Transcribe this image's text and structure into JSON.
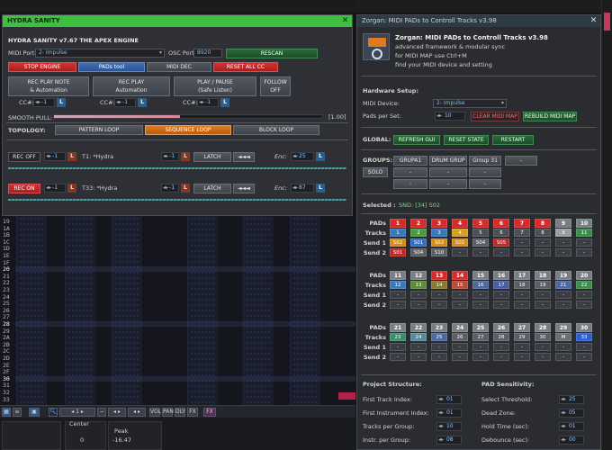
{
  "tracker": {
    "row_numbers": [
      "19",
      "1A",
      "1B",
      "1C",
      "1D",
      "1E",
      "1F",
      "20",
      "21",
      "22",
      "23",
      "24",
      "25",
      "26",
      "27",
      "28",
      "29",
      "2A",
      "2B",
      "2C",
      "2D",
      "2E",
      "2F",
      "30",
      "31",
      "32",
      "33"
    ],
    "highlight_rows": [
      "20",
      "28",
      "30"
    ]
  },
  "bottom_bar": {
    "zoom": "1",
    "items": [
      "VOL",
      "PAN",
      "DLY",
      "FX"
    ],
    "center_label": "Center",
    "center_value": "0",
    "peak_label": "Peak",
    "peak_value": "-16.47"
  },
  "hydra": {
    "window_title": "HYDRA SANITY",
    "header": "HYDRA SANITY v7.67  THE APEX ENGINE",
    "midi_port_label": "MIDI Port:",
    "midi_port_value": "2- Impulse",
    "osc_port_label": "OSC Port:",
    "osc_port_value": "8920",
    "rescan": "RESCAN",
    "stop_engine": "STOP ENGINE",
    "pads_tool": "PADs tool",
    "midi_dec": "MIDI DEC",
    "reset_all_cc": "RESET ALL CC",
    "rec_play_note": [
      "REC PLAY NOTE",
      "& Automation"
    ],
    "rec_play_auto": [
      "REC PLAY",
      "Automation"
    ],
    "play_pause": [
      "PLAY / PAUSE",
      "(Safe Listen)"
    ],
    "follow": [
      "FOLLOW",
      "OFF"
    ],
    "cc_label": "CC#:",
    "cc_value": "-1",
    "cc_chip": "L",
    "smooth_label": "SMOOTH PULL:",
    "smooth_value": "[1.00]",
    "smooth_fraction": 0.47,
    "topology_label": "TOPOLOGY:",
    "pattern_loop": "PATTERN LOOP",
    "sequence_loop": "SEQUENCE LOOP",
    "block_loop": "BLOCK LOOP",
    "tracks": [
      {
        "rec": "REC OFF",
        "rec_style": "dark",
        "num": "-1",
        "chip": "L",
        "name": "T1: *Hydra",
        "num2": "-1",
        "chip2": "L",
        "latch": "LATCH",
        "back": "◄◄◄",
        "enc_label": "Enc:",
        "enc": "25",
        "enc_chip": "L"
      },
      {
        "rec": "REC ON",
        "rec_style": "red",
        "num": "-1",
        "chip": "L",
        "name": "T33: *Hydra",
        "num2": "-1",
        "chip2": "L",
        "latch": "LATCH",
        "back": "◄◄◄",
        "enc_label": "Enc:",
        "enc": "87",
        "enc_chip": "L"
      }
    ]
  },
  "zorgan": {
    "window_title": "Zorgan: MIDI PADs to Controll Tracks v3.98",
    "app_title": "Zorgan: MIDI PADs to Controll Tracks v3.98",
    "desc1": "advanced framework & modular sync",
    "desc2": "for MIDI MAP use Ctrl+M",
    "desc3": "find your MIDI device and setting",
    "hw_setup": "Hardware Setup:",
    "midi_device_label": "MIDI Device:",
    "midi_device_value": "2- Impulse",
    "pads_per_set_label": "Pads per Set:",
    "pads_per_set_value": "10",
    "clear_midi_map": "CLEAR MIDI MAP",
    "rebuild_midi_map": "REBUILD MIDI MAP",
    "global_label": "GLOBAL:",
    "refresh_gui": "REFRESH GUI",
    "reset_state": "RESET STATE",
    "restart": "RESTART",
    "groups_label": "GROUPS:",
    "group_buttons": [
      "GRUPA1",
      "DRUM GRUP",
      "Group 31",
      "-"
    ],
    "solo": "SOLO",
    "dash": "-",
    "selected_label": "Selected :",
    "selected_value": "SND: [34] S02",
    "row_labels": [
      "PADs",
      "Tracks",
      "Send 1",
      "Send 2"
    ],
    "blocks": [
      {
        "pads": [
          [
            "1",
            "#d42c2c"
          ],
          [
            "2",
            "#d42c2c"
          ],
          [
            "3",
            "#d42c2c"
          ],
          [
            "4",
            "#d42c2c"
          ],
          [
            "5",
            "#d42c2c"
          ],
          [
            "6",
            "#d42c2c"
          ],
          [
            "7",
            "#d42c2c"
          ],
          [
            "8",
            "#d42c2c"
          ],
          [
            "9",
            "#7a7d83"
          ],
          [
            "10",
            "#7a7d83"
          ]
        ],
        "tracks": [
          [
            "1",
            "#3a7ab8"
          ],
          [
            "2",
            "#4c9a46"
          ],
          [
            "3",
            "#3a7ab8"
          ],
          [
            "4",
            "#d6a020"
          ],
          [
            "5",
            "#4a4f58"
          ],
          [
            "6",
            "#4a4f58"
          ],
          [
            "7",
            "#4a4f58"
          ],
          [
            "8",
            "#4a4f58"
          ],
          [
            "9",
            "#9a9da3"
          ],
          [
            "11",
            "#3d8d4a"
          ]
        ],
        "send1": [
          [
            "S02",
            "#d88a18"
          ],
          [
            "S01",
            "#2f6fd0"
          ],
          [
            "S02",
            "#d88a18"
          ],
          [
            "S02",
            "#d88a18"
          ],
          [
            "S04",
            "#5a5e66"
          ],
          [
            "S05",
            "#c02828"
          ],
          [
            "-",
            "#3a3d44"
          ],
          [
            "-",
            "#3a3d44"
          ],
          [
            "-",
            "#3a3d44"
          ],
          [
            "-",
            "#3a3d44"
          ]
        ],
        "send2": [
          [
            "S01",
            "#c02828"
          ],
          [
            "S04",
            "#5a5e66"
          ],
          [
            "S10",
            "#5a5e66"
          ],
          [
            "-",
            "#3a3d44"
          ],
          [
            "-",
            "#3a3d44"
          ],
          [
            "-",
            "#3a3d44"
          ],
          [
            "-",
            "#3a3d44"
          ],
          [
            "-",
            "#3a3d44"
          ],
          [
            "-",
            "#3a3d44"
          ],
          [
            "-",
            "#3a3d44"
          ]
        ]
      },
      {
        "pads": [
          [
            "11",
            "#7a7d83"
          ],
          [
            "12",
            "#7a7d83"
          ],
          [
            "13",
            "#d42c2c"
          ],
          [
            "14",
            "#d42c2c"
          ],
          [
            "15",
            "#7a7d83"
          ],
          [
            "16",
            "#7a7d83"
          ],
          [
            "17",
            "#7a7d83"
          ],
          [
            "18",
            "#7a7d83"
          ],
          [
            "19",
            "#7a7d83"
          ],
          [
            "20",
            "#7a7d83"
          ]
        ],
        "tracks": [
          [
            "12",
            "#3a7ab8"
          ],
          [
            "13",
            "#5a8a3a"
          ],
          [
            "14",
            "#8a7a30"
          ],
          [
            "15",
            "#b84a3a"
          ],
          [
            "16",
            "#4a6aa0"
          ],
          [
            "17",
            "#4a5fa0"
          ],
          [
            "18",
            "#5a5e66"
          ],
          [
            "19",
            "#5a5e66"
          ],
          [
            "21",
            "#4a6aa0"
          ],
          [
            "22",
            "#3d8d4a"
          ]
        ],
        "send1": [
          [
            "-",
            "#3a3d44"
          ],
          [
            "-",
            "#3a3d44"
          ],
          [
            "-",
            "#3a3d44"
          ],
          [
            "-",
            "#3a3d44"
          ],
          [
            "-",
            "#3a3d44"
          ],
          [
            "-",
            "#3a3d44"
          ],
          [
            "-",
            "#3a3d44"
          ],
          [
            "-",
            "#3a3d44"
          ],
          [
            "-",
            "#3a3d44"
          ],
          [
            "-",
            "#3a3d44"
          ]
        ],
        "send2": [
          [
            "-",
            "#3a3d44"
          ],
          [
            "-",
            "#3a3d44"
          ],
          [
            "-",
            "#3a3d44"
          ],
          [
            "-",
            "#3a3d44"
          ],
          [
            "-",
            "#3a3d44"
          ],
          [
            "-",
            "#3a3d44"
          ],
          [
            "-",
            "#3a3d44"
          ],
          [
            "-",
            "#3a3d44"
          ],
          [
            "-",
            "#3a3d44"
          ],
          [
            "-",
            "#3a3d44"
          ]
        ]
      },
      {
        "pads": [
          [
            "21",
            "#7a7d83"
          ],
          [
            "22",
            "#7a7d83"
          ],
          [
            "23",
            "#7a7d83"
          ],
          [
            "24",
            "#7a7d83"
          ],
          [
            "25",
            "#7a7d83"
          ],
          [
            "26",
            "#7a7d83"
          ],
          [
            "27",
            "#7a7d83"
          ],
          [
            "28",
            "#7a7d83"
          ],
          [
            "29",
            "#7a7d83"
          ],
          [
            "30",
            "#7a7d83"
          ]
        ],
        "tracks": [
          [
            "23",
            "#3d8d6a"
          ],
          [
            "24",
            "#5a8a9a"
          ],
          [
            "25",
            "#4a6aa0"
          ],
          [
            "26",
            "#5a5e66"
          ],
          [
            "27",
            "#5a5e66"
          ],
          [
            "28",
            "#5a5e66"
          ],
          [
            "29",
            "#5a5e66"
          ],
          [
            "30",
            "#5a5e66"
          ],
          [
            "M",
            "#6a6d73"
          ],
          [
            "33",
            "#2c5fd0"
          ]
        ],
        "send1": [
          [
            "-",
            "#3a3d44"
          ],
          [
            "-",
            "#3a3d44"
          ],
          [
            "-",
            "#3a3d44"
          ],
          [
            "-",
            "#3a3d44"
          ],
          [
            "-",
            "#3a3d44"
          ],
          [
            "-",
            "#3a3d44"
          ],
          [
            "-",
            "#3a3d44"
          ],
          [
            "-",
            "#3a3d44"
          ],
          [
            "-",
            "#3a3d44"
          ],
          [
            "-",
            "#3a3d44"
          ]
        ],
        "send2": [
          [
            "-",
            "#3a3d44"
          ],
          [
            "-",
            "#3a3d44"
          ],
          [
            "-",
            "#3a3d44"
          ],
          [
            "-",
            "#3a3d44"
          ],
          [
            "-",
            "#3a3d44"
          ],
          [
            "-",
            "#3a3d44"
          ],
          [
            "-",
            "#3a3d44"
          ],
          [
            "-",
            "#3a3d44"
          ],
          [
            "-",
            "#3a3d44"
          ],
          [
            "-",
            "#3a3d44"
          ]
        ]
      }
    ],
    "project_title": "Project Structure:",
    "project_rows": [
      {
        "label": "First Track Index:",
        "value": "01"
      },
      {
        "label": "First Instrument Index:",
        "value": "01"
      },
      {
        "label": "Tracks per Group:",
        "value": "10"
      },
      {
        "label": "Instr. per Group:",
        "value": "08"
      }
    ],
    "sens_title": "PAD Sensitivity:",
    "sens_rows": [
      {
        "label": "Select Threshold:",
        "value": "25"
      },
      {
        "label": "Dead Zone:",
        "value": "05"
      },
      {
        "label": "Hold Time (sec):",
        "value": "01"
      },
      {
        "label": "Debounce (sec):",
        "value": "00"
      }
    ]
  },
  "colors": {
    "hydra_title": "#3fbf3f",
    "zorgan_title": "#2f3b44",
    "accent_red": "#d42c2c",
    "accent_blue": "#3e6fb6",
    "accent_orange": "#e07a20"
  }
}
